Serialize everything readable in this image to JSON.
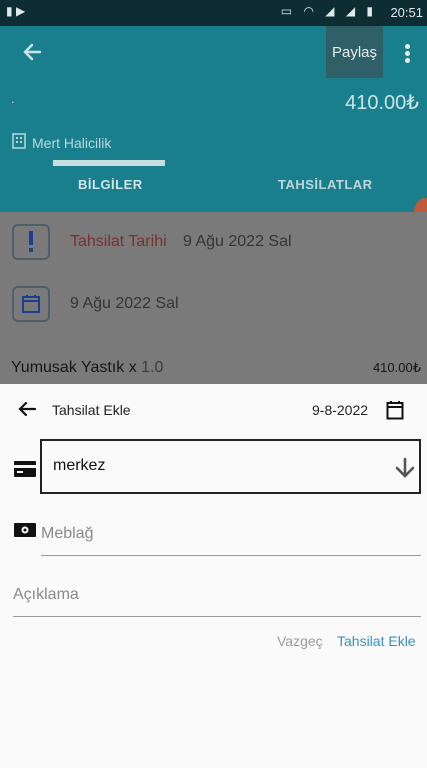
{
  "status_bar": {
    "time": "20:51"
  },
  "header": {
    "share_label": "Paylaş",
    "dot_text": ".",
    "amount": "410.00₺",
    "company": "Mert Halicilik",
    "tabs": [
      {
        "label": "BİLGİLER",
        "active": true
      },
      {
        "label": "TAHSİLATLAR",
        "active": false
      }
    ]
  },
  "details": {
    "collection_date_label": "Tahsilat Tarihi",
    "collection_date_value": "9 Ağu 2022 Sal",
    "date_value": "9 Ağu 2022 Sal",
    "item_name": "Yumusak Yastık x",
    "item_qty": "1.0",
    "item_price": "410.00₺"
  },
  "sheet": {
    "title": "Tahsilat Ekle",
    "date": "9-8-2022",
    "account_value": "merkez",
    "amount_placeholder": "Meblağ",
    "description_placeholder": "Açıklama",
    "cancel_label": "Vazgeç",
    "submit_label": "Tahsilat Ekle"
  },
  "colors": {
    "header_bg": "#1a7f8c",
    "accent_link": "#3a8fc4",
    "danger_label": "#7b2f2f"
  }
}
